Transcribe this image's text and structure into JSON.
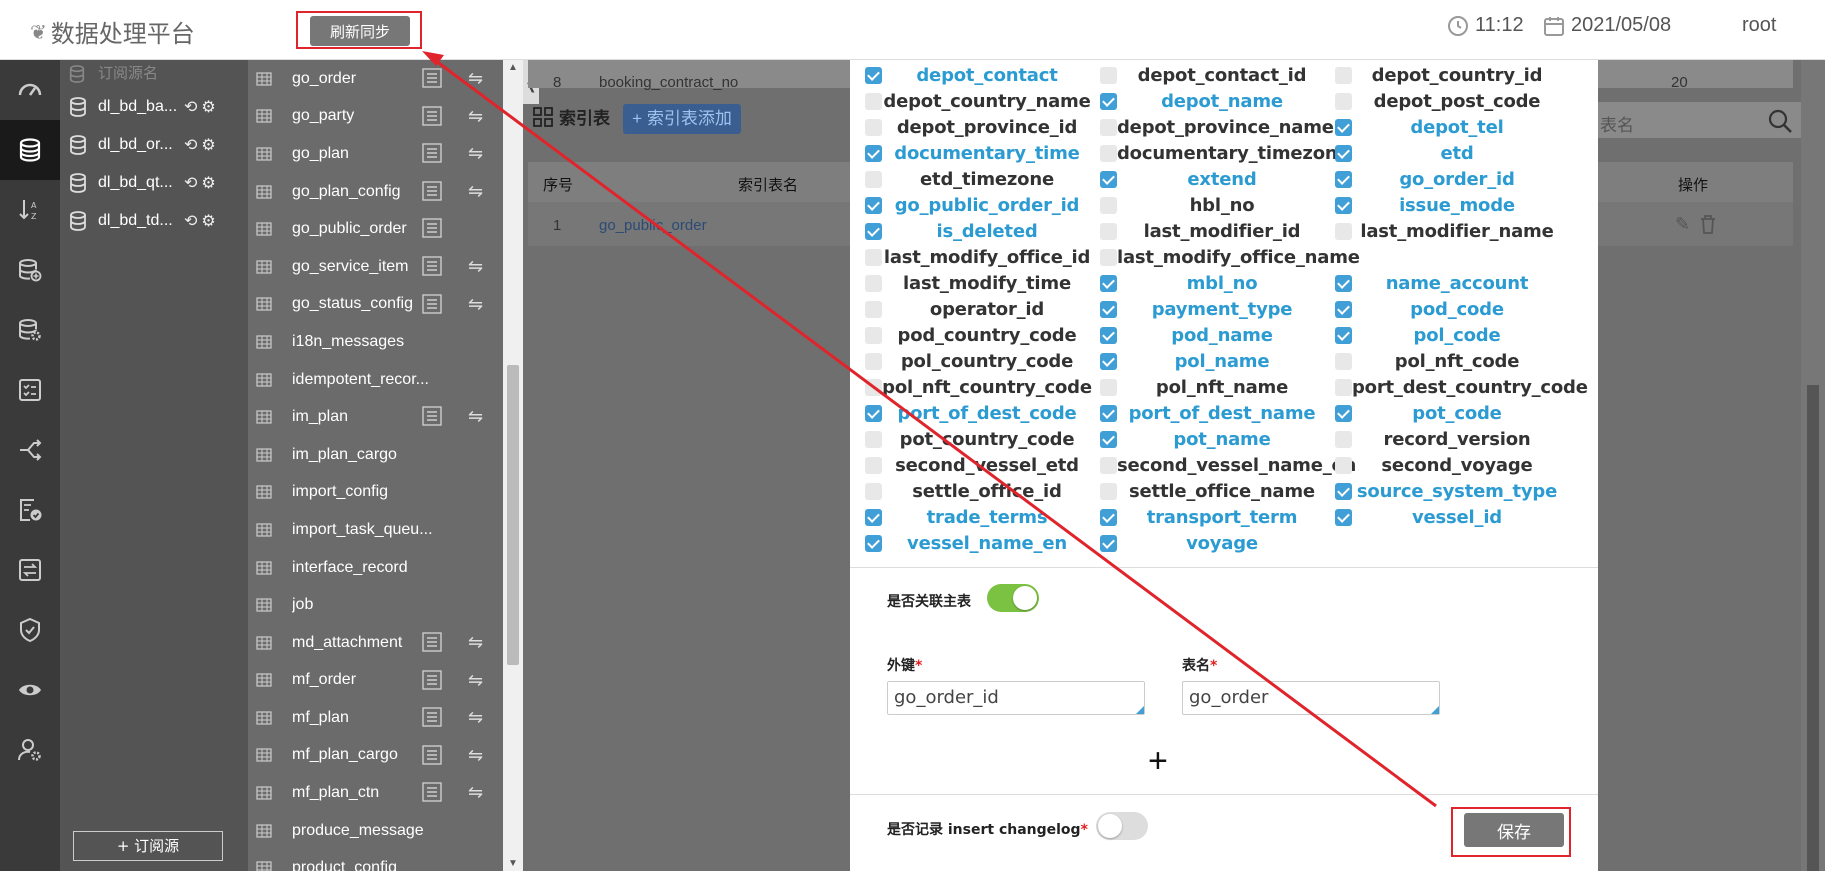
{
  "header": {
    "app_title": "数据处理平台",
    "refresh_label": "刷新同步",
    "time": "11:12",
    "date": "2021/05/08",
    "user": "root"
  },
  "rail": {
    "icons": [
      "dashboard-icon",
      "database-icon",
      "sort-icon",
      "database-add-icon",
      "database-settings-icon",
      "checklist-icon",
      "share-icon",
      "report-check-icon",
      "exchange-icon",
      "shield-check-icon",
      "eye-icon",
      "user-settings-icon"
    ]
  },
  "subscriptions": {
    "header": "订阅源名",
    "items": [
      "dl_bd_ba...",
      "dl_bd_or...",
      "dl_bd_qt...",
      "dl_bd_td..."
    ],
    "add_label": "+ 订阅源"
  },
  "tables": [
    {
      "name": "go_order",
      "detail": true,
      "sync": true
    },
    {
      "name": "go_party",
      "detail": true,
      "sync": true
    },
    {
      "name": "go_plan",
      "detail": true,
      "sync": true
    },
    {
      "name": "go_plan_config",
      "detail": true,
      "sync": true
    },
    {
      "name": "go_public_order",
      "detail": true,
      "sync": false
    },
    {
      "name": "go_service_item",
      "detail": true,
      "sync": true
    },
    {
      "name": "go_status_config",
      "detail": true,
      "sync": true
    },
    {
      "name": "i18n_messages",
      "detail": false,
      "sync": false
    },
    {
      "name": "idempotent_recor...",
      "detail": false,
      "sync": false
    },
    {
      "name": "im_plan",
      "detail": true,
      "sync": true
    },
    {
      "name": "im_plan_cargo",
      "detail": false,
      "sync": false
    },
    {
      "name": "import_config",
      "detail": false,
      "sync": false
    },
    {
      "name": "import_task_queu...",
      "detail": false,
      "sync": false
    },
    {
      "name": "interface_record",
      "detail": false,
      "sync": false
    },
    {
      "name": "job",
      "detail": false,
      "sync": false
    },
    {
      "name": "md_attachment",
      "detail": true,
      "sync": true
    },
    {
      "name": "mf_order",
      "detail": true,
      "sync": true
    },
    {
      "name": "mf_plan",
      "detail": true,
      "sync": true
    },
    {
      "name": "mf_plan_cargo",
      "detail": true,
      "sync": true
    },
    {
      "name": "mf_plan_ctn",
      "detail": true,
      "sync": true
    },
    {
      "name": "produce_message",
      "detail": false,
      "sync": false
    },
    {
      "name": "product_config",
      "detail": false,
      "sync": false
    }
  ],
  "background": {
    "row_num": "8",
    "row_text": "booking_contract_no",
    "row_val": "20",
    "index_title": "索引表",
    "index_add": "+ 索引表添加",
    "search_placeholder": "表名",
    "col_seq": "序号",
    "col_name": "索引表名",
    "col_ops": "操作",
    "idx_row_num": "1",
    "idx_row_name": "go_public_order"
  },
  "modal": {
    "columns": [
      {
        "name": "depot_contact",
        "checked": true
      },
      {
        "name": "depot_contact_id",
        "checked": false
      },
      {
        "name": "depot_country_id",
        "checked": false
      },
      {
        "name": "depot_country_name",
        "checked": false
      },
      {
        "name": "depot_name",
        "checked": true
      },
      {
        "name": "depot_post_code",
        "checked": false
      },
      {
        "name": "depot_province_id",
        "checked": false
      },
      {
        "name": "depot_province_name",
        "checked": false
      },
      {
        "name": "depot_tel",
        "checked": true
      },
      {
        "name": "documentary_time",
        "checked": true
      },
      {
        "name": "documentary_timezone",
        "checked": false
      },
      {
        "name": "etd",
        "checked": true
      },
      {
        "name": "etd_timezone",
        "checked": false
      },
      {
        "name": "extend",
        "checked": true
      },
      {
        "name": "go_order_id",
        "checked": true
      },
      {
        "name": "go_public_order_id",
        "checked": true
      },
      {
        "name": "hbl_no",
        "checked": false
      },
      {
        "name": "issue_mode",
        "checked": true
      },
      {
        "name": "is_deleted",
        "checked": true
      },
      {
        "name": "last_modifier_id",
        "checked": false
      },
      {
        "name": "last_modifier_name",
        "checked": false
      },
      {
        "name": "last_modify_office_id",
        "checked": false
      },
      {
        "name": "last_modify_office_name",
        "checked": false
      },
      {
        "name": "",
        "checked": null
      },
      {
        "name": "last_modify_time",
        "checked": false
      },
      {
        "name": "mbl_no",
        "checked": true
      },
      {
        "name": "name_account",
        "checked": true
      },
      {
        "name": "operator_id",
        "checked": false
      },
      {
        "name": "payment_type",
        "checked": true
      },
      {
        "name": "pod_code",
        "checked": true
      },
      {
        "name": "pod_country_code",
        "checked": false
      },
      {
        "name": "pod_name",
        "checked": true
      },
      {
        "name": "pol_code",
        "checked": true
      },
      {
        "name": "pol_country_code",
        "checked": false
      },
      {
        "name": "pol_name",
        "checked": true
      },
      {
        "name": "pol_nft_code",
        "checked": false
      },
      {
        "name": "pol_nft_country_code",
        "checked": false
      },
      {
        "name": "pol_nft_name",
        "checked": false
      },
      {
        "name": "port_dest_country_code",
        "checked": false
      },
      {
        "name": "port_of_dest_code",
        "checked": true
      },
      {
        "name": "port_of_dest_name",
        "checked": true
      },
      {
        "name": "pot_code",
        "checked": true
      },
      {
        "name": "pot_country_code",
        "checked": false
      },
      {
        "name": "pot_name",
        "checked": true
      },
      {
        "name": "record_version",
        "checked": false
      },
      {
        "name": "second_vessel_etd",
        "checked": false
      },
      {
        "name": "second_vessel_name_en",
        "checked": false
      },
      {
        "name": "second_voyage",
        "checked": false
      },
      {
        "name": "settle_office_id",
        "checked": false
      },
      {
        "name": "settle_office_name",
        "checked": false
      },
      {
        "name": "source_system_type",
        "checked": true
      },
      {
        "name": "trade_terms",
        "checked": true
      },
      {
        "name": "transport_term",
        "checked": true
      },
      {
        "name": "vessel_id",
        "checked": true
      },
      {
        "name": "vessel_name_en",
        "checked": true
      },
      {
        "name": "voyage",
        "checked": true
      }
    ],
    "link_main_label": "是否关联主表",
    "link_main_on": true,
    "fk_label": "外键",
    "fk_value": "go_order_id",
    "table_label": "表名",
    "table_value": "go_order",
    "changelog_label": "是否记录 insert changelog",
    "changelog_on": false,
    "save_label": "保存"
  },
  "colors": {
    "accent": "#3f9fd6",
    "toggle_on": "#7cc242",
    "annotation": "#e0242b"
  }
}
